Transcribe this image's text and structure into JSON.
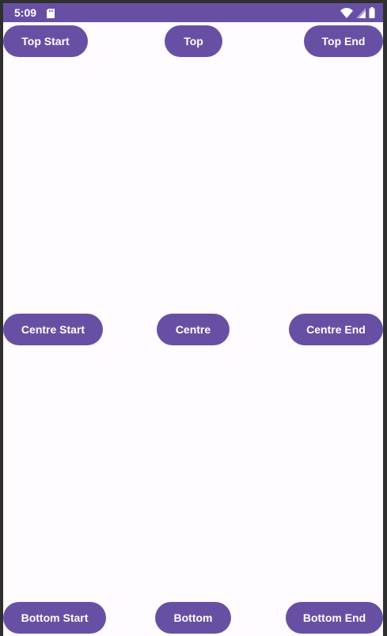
{
  "status_bar": {
    "time": "5:09",
    "icons": [
      "sd-card-icon",
      "wifi-icon",
      "signal-icon",
      "battery-icon"
    ],
    "color": "#6750a4"
  },
  "buttons": {
    "top_start": "Top Start",
    "top": "Top",
    "top_end": "Top End",
    "centre_start": "Centre Start",
    "centre": "Centre",
    "centre_end": "Centre End",
    "bottom_start": "Bottom Start",
    "bottom": "Bottom",
    "bottom_end": "Bottom End"
  },
  "colors": {
    "primary": "#6750a4",
    "on_primary": "#ffffff",
    "background": "#fffbfe"
  }
}
